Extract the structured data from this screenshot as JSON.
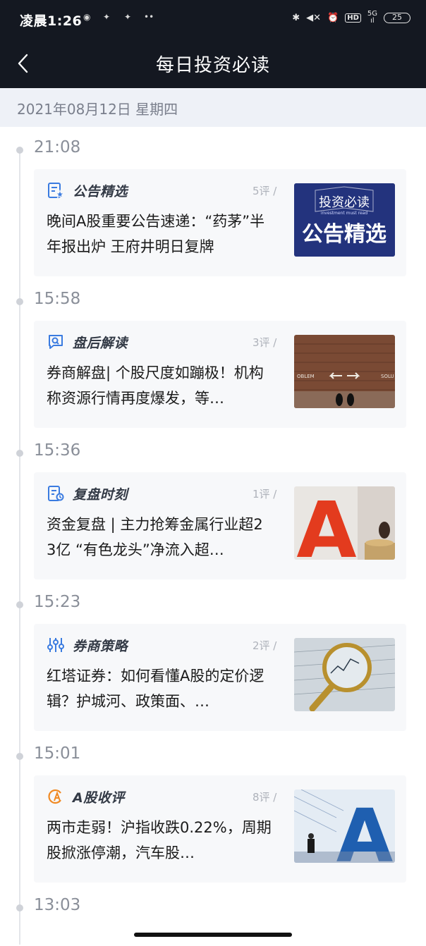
{
  "status_bar": {
    "time": "凌晨1:26",
    "net_top": "5G",
    "net_bottom": "ıl",
    "hd": "HD",
    "battery": "25"
  },
  "nav": {
    "title": "每日投资必读",
    "back_icon": "chevron-left-icon"
  },
  "date_header": "2021年08月12日 星期四",
  "entries": [
    {
      "time": "21:08",
      "category": "公告精选",
      "category_icon": "document-star-icon",
      "comments": "5评 /",
      "headline": "晚间A股重要公告速递：“药茅”半年报出炉 王府井明日复牌",
      "thumb_icon": "announcement-banner-image",
      "thumb_text_top": "投资必读",
      "thumb_text_sub": "investment must read",
      "thumb_text_main": "公告精选"
    },
    {
      "time": "15:58",
      "category": "盘后解读",
      "category_icon": "chat-search-icon",
      "comments": "3评 /",
      "headline": "券商解盘| 个股尺度如蹦极！机构称资源行情再度爆发，等…",
      "thumb_icon": "brick-wall-arrows-image",
      "thumb_left": "OBLEM",
      "thumb_right": "SOLU"
    },
    {
      "time": "15:36",
      "category": "复盘时刻",
      "category_icon": "document-refresh-icon",
      "comments": "1评 /",
      "headline": "资金复盘 | 主力抢筹金属行业超23亿 “有色龙头”净流入超…",
      "thumb_icon": "red-letter-a-coins-image",
      "thumb_letter": "A"
    },
    {
      "time": "15:23",
      "category": "券商策略",
      "category_icon": "sliders-icon",
      "comments": "2评 /",
      "headline": "红塔证券：如何看懂A股的定价逻辑？护城河、政策面、…",
      "thumb_icon": "magnifier-chart-image"
    },
    {
      "time": "15:01",
      "category": "A股收评",
      "category_icon": "a-share-review-icon",
      "comments": "8评 /",
      "headline": "两市走弱！沪指收跌0.22%，周期股掀涨停潮，汽车股…",
      "thumb_icon": "blue-letter-a-businessman-image",
      "thumb_letter": "A"
    },
    {
      "time": "13:03"
    }
  ],
  "colors": {
    "topbar": "#141821",
    "date_bar": "#eef1f7",
    "card_bg": "#f7f8fa",
    "icon_blue": "#3a7be0",
    "icon_orange": "#f08a24"
  }
}
